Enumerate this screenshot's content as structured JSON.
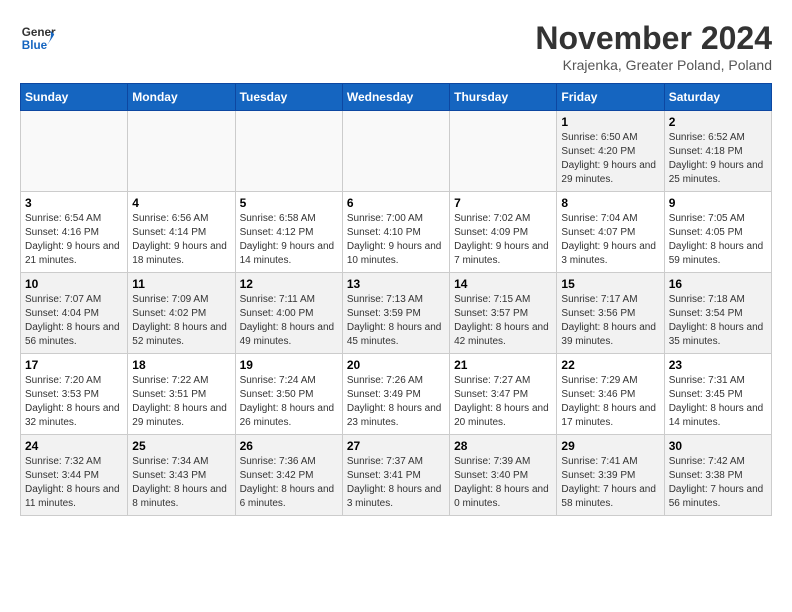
{
  "logo": {
    "line1": "General",
    "line2": "Blue"
  },
  "title": "November 2024",
  "subtitle": "Krajenka, Greater Poland, Poland",
  "weekdays": [
    "Sunday",
    "Monday",
    "Tuesday",
    "Wednesday",
    "Thursday",
    "Friday",
    "Saturday"
  ],
  "weeks": [
    [
      {
        "day": "",
        "empty": true
      },
      {
        "day": "",
        "empty": true
      },
      {
        "day": "",
        "empty": true
      },
      {
        "day": "",
        "empty": true
      },
      {
        "day": "",
        "empty": true
      },
      {
        "day": "1",
        "sunrise": "6:50 AM",
        "sunset": "4:20 PM",
        "daylight": "9 hours and 29 minutes."
      },
      {
        "day": "2",
        "sunrise": "6:52 AM",
        "sunset": "4:18 PM",
        "daylight": "9 hours and 25 minutes."
      }
    ],
    [
      {
        "day": "3",
        "sunrise": "6:54 AM",
        "sunset": "4:16 PM",
        "daylight": "9 hours and 21 minutes."
      },
      {
        "day": "4",
        "sunrise": "6:56 AM",
        "sunset": "4:14 PM",
        "daylight": "9 hours and 18 minutes."
      },
      {
        "day": "5",
        "sunrise": "6:58 AM",
        "sunset": "4:12 PM",
        "daylight": "9 hours and 14 minutes."
      },
      {
        "day": "6",
        "sunrise": "7:00 AM",
        "sunset": "4:10 PM",
        "daylight": "9 hours and 10 minutes."
      },
      {
        "day": "7",
        "sunrise": "7:02 AM",
        "sunset": "4:09 PM",
        "daylight": "9 hours and 7 minutes."
      },
      {
        "day": "8",
        "sunrise": "7:04 AM",
        "sunset": "4:07 PM",
        "daylight": "9 hours and 3 minutes."
      },
      {
        "day": "9",
        "sunrise": "7:05 AM",
        "sunset": "4:05 PM",
        "daylight": "8 hours and 59 minutes."
      }
    ],
    [
      {
        "day": "10",
        "sunrise": "7:07 AM",
        "sunset": "4:04 PM",
        "daylight": "8 hours and 56 minutes."
      },
      {
        "day": "11",
        "sunrise": "7:09 AM",
        "sunset": "4:02 PM",
        "daylight": "8 hours and 52 minutes."
      },
      {
        "day": "12",
        "sunrise": "7:11 AM",
        "sunset": "4:00 PM",
        "daylight": "8 hours and 49 minutes."
      },
      {
        "day": "13",
        "sunrise": "7:13 AM",
        "sunset": "3:59 PM",
        "daylight": "8 hours and 45 minutes."
      },
      {
        "day": "14",
        "sunrise": "7:15 AM",
        "sunset": "3:57 PM",
        "daylight": "8 hours and 42 minutes."
      },
      {
        "day": "15",
        "sunrise": "7:17 AM",
        "sunset": "3:56 PM",
        "daylight": "8 hours and 39 minutes."
      },
      {
        "day": "16",
        "sunrise": "7:18 AM",
        "sunset": "3:54 PM",
        "daylight": "8 hours and 35 minutes."
      }
    ],
    [
      {
        "day": "17",
        "sunrise": "7:20 AM",
        "sunset": "3:53 PM",
        "daylight": "8 hours and 32 minutes."
      },
      {
        "day": "18",
        "sunrise": "7:22 AM",
        "sunset": "3:51 PM",
        "daylight": "8 hours and 29 minutes."
      },
      {
        "day": "19",
        "sunrise": "7:24 AM",
        "sunset": "3:50 PM",
        "daylight": "8 hours and 26 minutes."
      },
      {
        "day": "20",
        "sunrise": "7:26 AM",
        "sunset": "3:49 PM",
        "daylight": "8 hours and 23 minutes."
      },
      {
        "day": "21",
        "sunrise": "7:27 AM",
        "sunset": "3:47 PM",
        "daylight": "8 hours and 20 minutes."
      },
      {
        "day": "22",
        "sunrise": "7:29 AM",
        "sunset": "3:46 PM",
        "daylight": "8 hours and 17 minutes."
      },
      {
        "day": "23",
        "sunrise": "7:31 AM",
        "sunset": "3:45 PM",
        "daylight": "8 hours and 14 minutes."
      }
    ],
    [
      {
        "day": "24",
        "sunrise": "7:32 AM",
        "sunset": "3:44 PM",
        "daylight": "8 hours and 11 minutes."
      },
      {
        "day": "25",
        "sunrise": "7:34 AM",
        "sunset": "3:43 PM",
        "daylight": "8 hours and 8 minutes."
      },
      {
        "day": "26",
        "sunrise": "7:36 AM",
        "sunset": "3:42 PM",
        "daylight": "8 hours and 6 minutes."
      },
      {
        "day": "27",
        "sunrise": "7:37 AM",
        "sunset": "3:41 PM",
        "daylight": "8 hours and 3 minutes."
      },
      {
        "day": "28",
        "sunrise": "7:39 AM",
        "sunset": "3:40 PM",
        "daylight": "8 hours and 0 minutes."
      },
      {
        "day": "29",
        "sunrise": "7:41 AM",
        "sunset": "3:39 PM",
        "daylight": "7 hours and 58 minutes."
      },
      {
        "day": "30",
        "sunrise": "7:42 AM",
        "sunset": "3:38 PM",
        "daylight": "7 hours and 56 minutes."
      }
    ]
  ]
}
